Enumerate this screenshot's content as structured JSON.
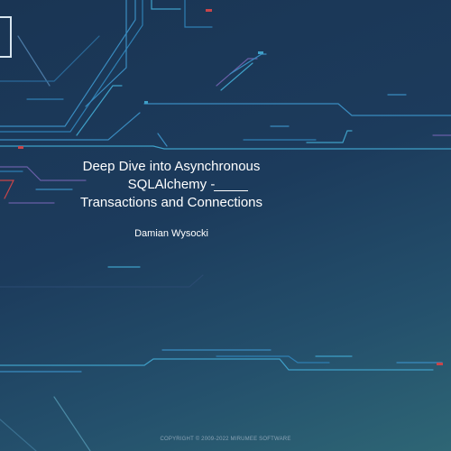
{
  "slide": {
    "title_lines": [
      "Deep Dive into Asynchronous",
      "SQLAlchemy -",
      "Transactions and Connections"
    ],
    "author": "Damian Wysocki",
    "copyright": "COPYRIGHT © 2009-2022 MIRUMEE SOFTWARE"
  },
  "colors": {
    "background_top": "#1a3554",
    "background_bottom": "#2e6675",
    "circuit_blue": "#2f7fb3",
    "circuit_cyan": "#3fa0c8",
    "circuit_purple": "#6a5fa8",
    "accent_red": "#c8454a",
    "text": "#ffffff"
  }
}
